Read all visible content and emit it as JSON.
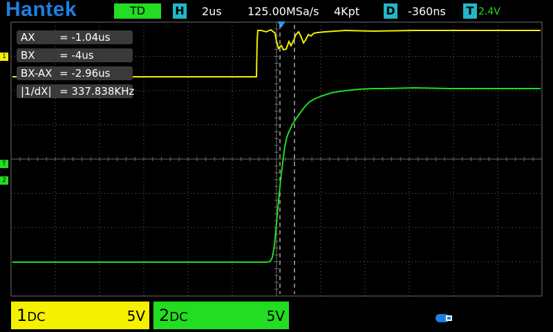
{
  "header": {
    "brand": "Hantek",
    "mode": "TD",
    "h_label": "H",
    "timebase": "2us",
    "sample_rate": "125.00MSa/s",
    "memory_depth": "4Kpt",
    "d_label": "D",
    "delay": "-360ns",
    "t_label": "T",
    "trigger_level": "2.4V"
  },
  "cursors": {
    "ax": {
      "label": "AX",
      "value": "= -1.04us"
    },
    "bx": {
      "label": "BX",
      "value": "= -4us"
    },
    "diff": {
      "label": "BX-AX",
      "value": "= -2.96us"
    },
    "freq": {
      "label": "|1/dX|",
      "value": "= 337.838KHz"
    }
  },
  "markers": {
    "ch1": "1",
    "trigger": "T",
    "ch2": "2"
  },
  "channels": [
    {
      "name": "1",
      "coupling": "DC",
      "scale": "5V"
    },
    {
      "name": "2",
      "coupling": "DC",
      "scale": "5V"
    }
  ],
  "colors": {
    "ch1": "#f5f000",
    "ch2": "#22dd22",
    "brand": "#1e7fe0",
    "accent": "#20b8c8",
    "grid": "#6e6e6e"
  },
  "icons": {
    "usb": "usb-icon"
  }
}
